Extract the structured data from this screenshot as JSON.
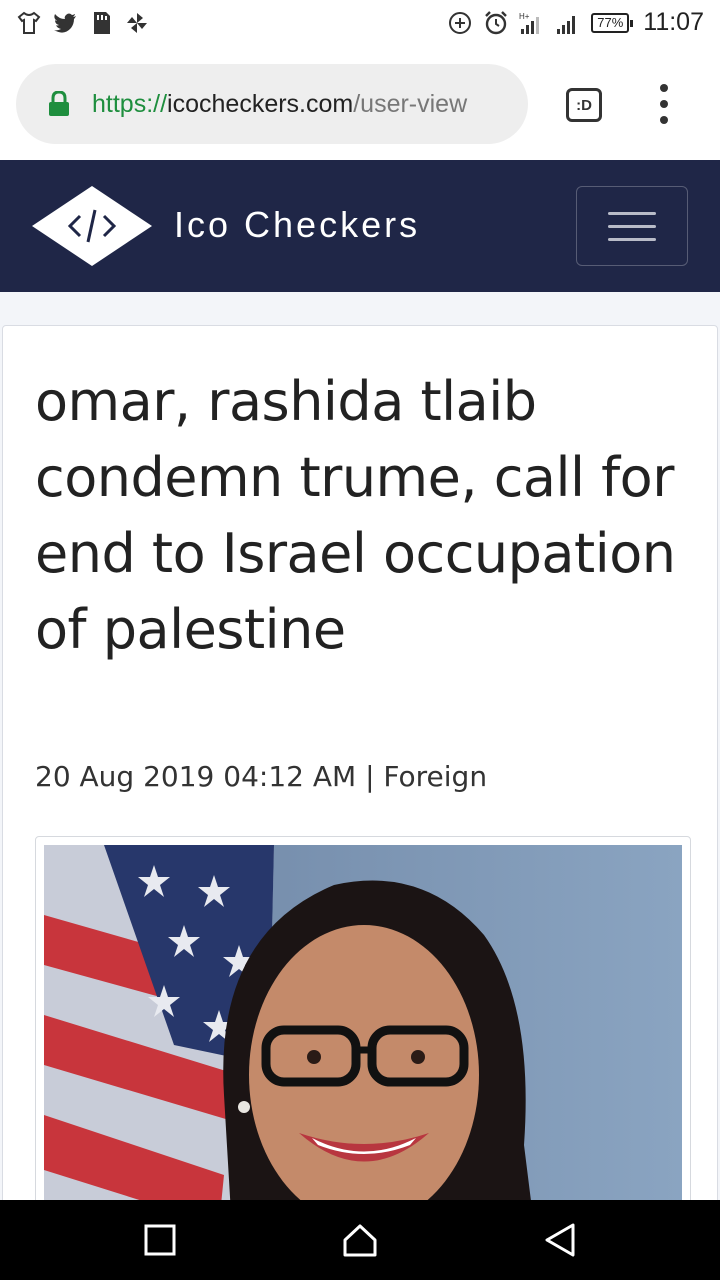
{
  "status_bar": {
    "battery": "77%",
    "time": "11:07"
  },
  "browser": {
    "url_scheme": "https://",
    "url_host": "icocheckers.com",
    "url_path": "/user-view",
    "tab_label": ":D"
  },
  "site": {
    "brand": "Ico Checkers"
  },
  "article": {
    "title": "omar, rashida tlaib condemn trume, call for end to Israel occupation of palestine",
    "meta": "20 Aug 2019 04:12 AM | Foreign"
  },
  "colors": {
    "header_bg": "#1f2647",
    "lock_green": "#1e8e3e"
  }
}
